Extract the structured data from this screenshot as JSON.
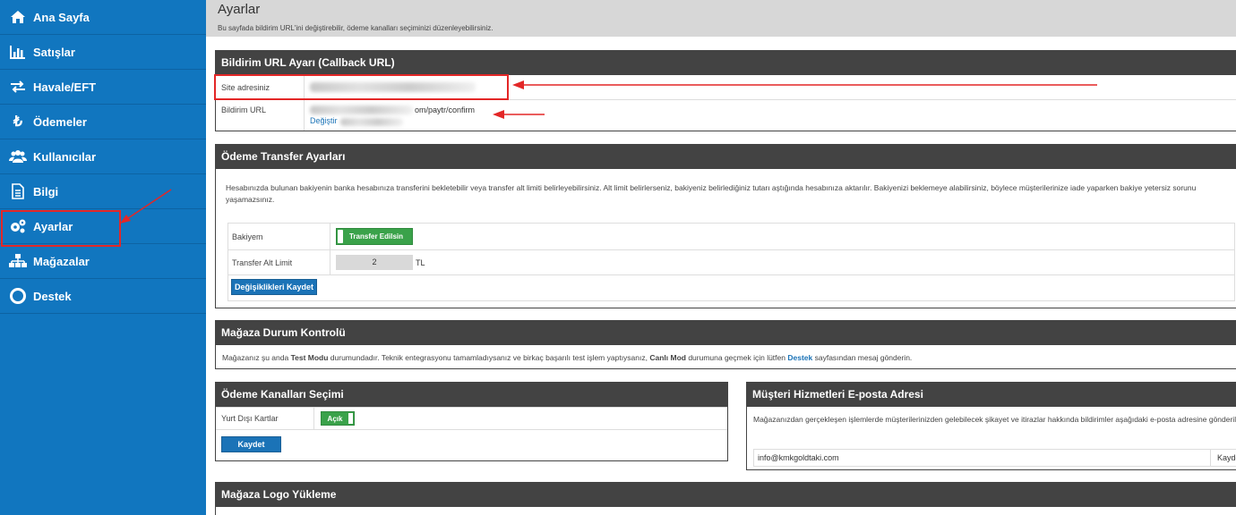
{
  "sidebar": {
    "items": [
      {
        "label": "Ana Sayfa"
      },
      {
        "label": "Satışlar"
      },
      {
        "label": "Havale/EFT"
      },
      {
        "label": "Ödemeler"
      },
      {
        "label": "Kullanıcılar"
      },
      {
        "label": "Bilgi"
      },
      {
        "label": "Ayarlar"
      },
      {
        "label": "Mağazalar"
      },
      {
        "label": "Destek"
      }
    ]
  },
  "header": {
    "title": "Ayarlar",
    "subtitle": "Bu sayfada bildirim URL'ini değiştirebilir, ödeme kanalları seçiminizi düzenleyebilirsiniz."
  },
  "callback": {
    "title": "Bildirim URL Ayarı (Callback URL)",
    "site_label": "Site adresiniz",
    "notify_label": "Bildirim URL",
    "notify_value": "om/paytr/confirm",
    "change_link": "Değiştir"
  },
  "transfer": {
    "title": "Ödeme Transfer Ayarları",
    "description": "Hesabınızda bulunan bakiyenin banka hesabınıza transferini bekletebilir veya transfer alt limiti belirleyebilirsiniz. Alt limit belirlerseniz, bakiyeniz belirlediğiniz tutarı aştığında hesabınıza aktarılır. Bakiyenizi beklemeye alabilirsiniz, böylece müşterilerinize iade yaparken bakiye yetersiz sorunu yaşamazsınız.",
    "balance_label": "Bakiyem",
    "balance_toggle": "Transfer Edilsin",
    "limit_label": "Transfer Alt Limit",
    "limit_value": "2",
    "limit_unit": "TL",
    "save_label": "Değişiklikleri Kaydet"
  },
  "store_status": {
    "title": "Mağaza Durum Kontrolü",
    "text_1": "Mağazanız şu anda ",
    "mode_test": "Test Modu",
    "text_2": " durumundadır. Teknik entegrasyonu tamamladıysanız ve birkaç başarılı test işlem yaptıysanız, ",
    "mode_live": "Canlı Mod",
    "text_3": " durumuna geçmek için lütfen ",
    "support_link": "Destek",
    "text_4": " sayfasından mesaj gönderin."
  },
  "channels": {
    "title": "Ödeme Kanalları Seçimi",
    "foreign_label": "Yurt Dışı Kartlar",
    "foreign_toggle": "Açık",
    "save_label": "Kaydet"
  },
  "support_email": {
    "title": "Müşteri Hizmetleri E-posta Adresi",
    "description": "Mağazanızdan gerçekleşen işlemlerde müşterilerinizden gelebilecek şikayet ve itirazlar hakkında bildirimler aşağıdaki e-posta adresine gönderilecektir.",
    "email_value": "info@kmkgoldtaki.com",
    "save_label": "Kaydet"
  },
  "logo": {
    "title": "Mağaza Logo Yükleme"
  },
  "colors": {
    "sidebar": "#1176bf",
    "panel_head": "#434343",
    "accent_green": "#3aa24a",
    "button_blue": "#1b73b7",
    "annotation_red": "#e32727"
  }
}
